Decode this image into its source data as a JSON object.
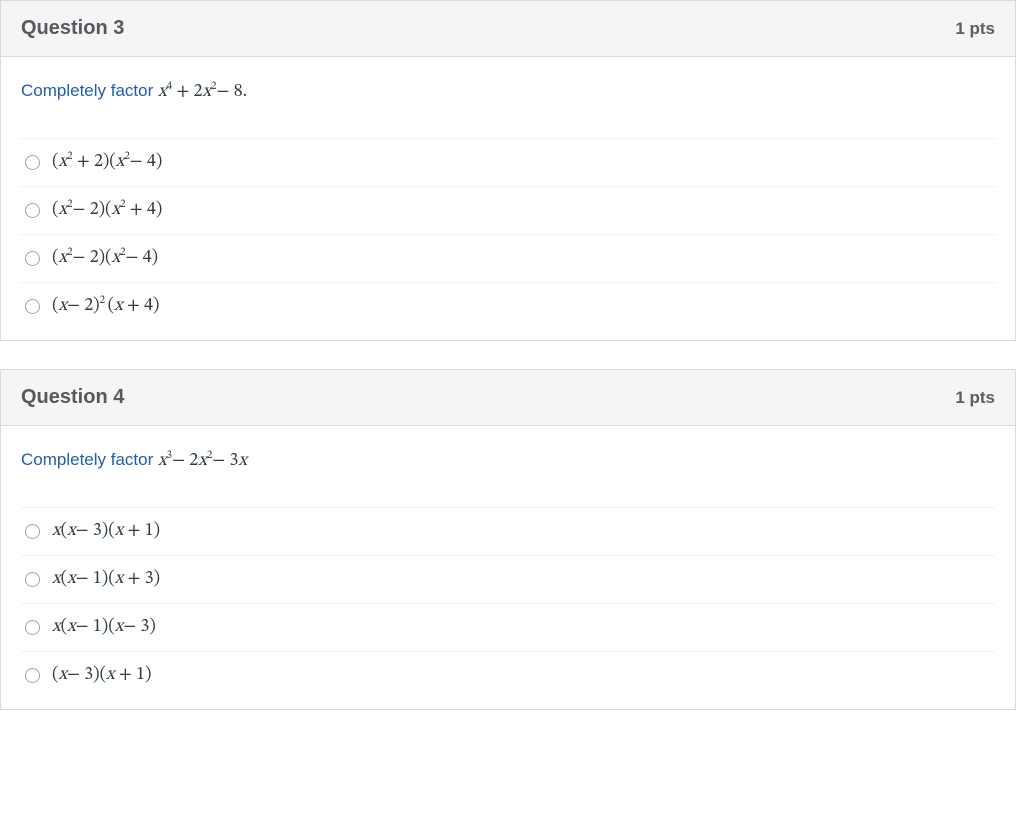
{
  "questions": [
    {
      "title": "Question 3",
      "points": "1 pts",
      "prompt_html": "Completely factor <span class='math'>x<sup>4</sup> <span class='n'>+ 2</span>x<sup>2</sup><span class='n'>− 8.</span></span>",
      "options": [
        "<span class='math'><span class='n'>(</span>x<sup>2</sup> <span class='n'>+ 2)(</span>x<sup>2</sup><span class='n'>− 4)</span></span>",
        "<span class='math'><span class='n'>(</span>x<sup>2</sup><span class='n'>− 2)(</span>x<sup>2</sup> <span class='n'>+ 4)</span></span>",
        "<span class='math'><span class='n'>(</span>x<sup>2</sup><span class='n'>− 2)(</span>x<sup>2</sup><span class='n'>− 4)</span></span>",
        "<span class='math'><span class='n'>(</span>x<span class='n'>− 2)</span><sup>2 </sup><span class='n'>(</span>x <span class='n'>+ 4)</span></span>"
      ]
    },
    {
      "title": "Question 4",
      "points": "1 pts",
      "prompt_html": "Completely factor <span class='math'>x<sup>3</sup><span class='n'>− 2</span>x<sup>2</sup><span class='n'>− 3</span>x</span>",
      "options": [
        "<span class='math'>x<span class='n'>(</span>x<span class='n'>− 3)(</span>x <span class='n'>+ 1)</span></span>",
        "<span class='math'>x<span class='n'>(</span>x<span class='n'>− 1)(</span>x <span class='n'>+ 3)</span></span>",
        "<span class='math'>x<span class='n'>(</span>x<span class='n'>− 1)(</span>x<span class='n'>− 3)</span></span>",
        "<span class='math'><span class='n'>(</span>x<span class='n'>− 3)(</span>x <span class='n'>+ 1)</span></span>"
      ]
    }
  ]
}
